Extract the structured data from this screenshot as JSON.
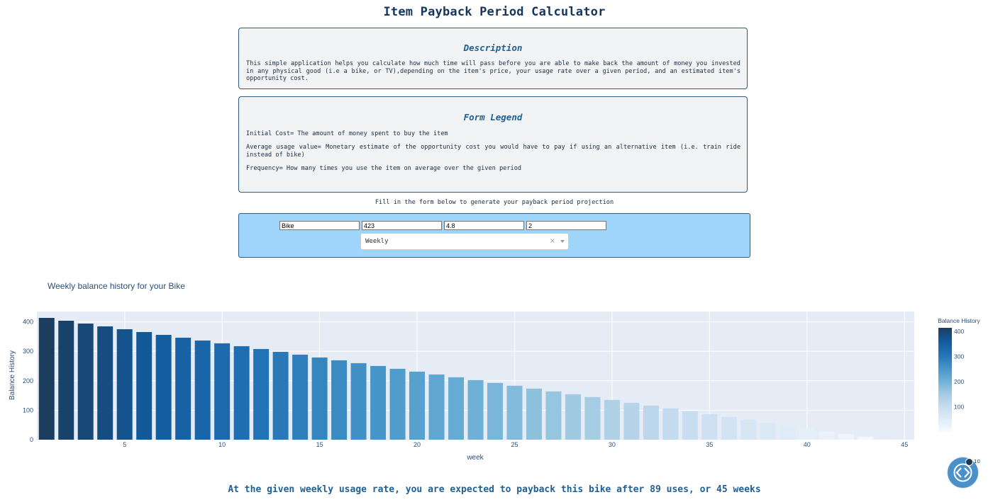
{
  "app": {
    "title": "Item Payback Period Calculator",
    "instruction": "Fill in the form below to generate your payback period projection",
    "result": "At the given weekly usage rate, you are expected to payback this bike after 89 uses, or 45 weeks"
  },
  "description": {
    "heading": "Description",
    "text": "This simple application helps you calculate how much time will pass before you are able to make back the amount of money you invested in any physical good (i.e a bike, or TV),depending on the item's price, your usage rate over a given period, and an estimated item's opportunity cost."
  },
  "legend": {
    "heading": "Form Legend",
    "initial_cost": "Initial Cost= The amount of money spent to buy the item",
    "average_usage": "Average usage value= Monetary estimate of the opportunity cost you would have to pay if using an alternative item (i.e. train ride instead of bike)",
    "frequency": "Frequency= How many times you use the item on average over the given period"
  },
  "form": {
    "item_value": "Bike",
    "initial_cost_value": "423",
    "usage_value": "4.8",
    "frequency_value": "2",
    "period_selected": "Weekly"
  },
  "fab": {
    "count": "10"
  },
  "colors": {
    "accent": "#1f5f93",
    "form_bg": "#9fd5fb",
    "plot_bg": "#e5ecf6",
    "bar_high": "#1b3d5e",
    "bar_low": "#f7f9fc"
  },
  "chart_data": {
    "type": "bar",
    "title": "Weekly balance history for your Bike",
    "xlabel": "week",
    "ylabel": "Balance History",
    "colorbar_title": "Balance History",
    "x": [
      1,
      2,
      3,
      4,
      5,
      6,
      7,
      8,
      9,
      10,
      11,
      12,
      13,
      14,
      15,
      16,
      17,
      18,
      19,
      20,
      21,
      22,
      23,
      24,
      25,
      26,
      27,
      28,
      29,
      30,
      31,
      32,
      33,
      34,
      35,
      36,
      37,
      38,
      39,
      40,
      41,
      42,
      43,
      44,
      45
    ],
    "values": [
      413.4,
      403.8,
      394.2,
      384.6,
      375,
      365.4,
      355.8,
      346.2,
      336.6,
      327,
      317.4,
      307.8,
      298.2,
      288.6,
      279,
      269.4,
      259.8,
      250.2,
      240.6,
      231,
      221.4,
      211.8,
      202.2,
      192.6,
      183,
      173.4,
      163.8,
      154.2,
      144.6,
      135,
      125.4,
      115.8,
      106.2,
      96.6,
      87,
      77.4,
      67.8,
      58.2,
      48.6,
      39,
      29.4,
      19.8,
      10.2,
      0.6,
      0
    ],
    "xlim": [
      0.5,
      45.5
    ],
    "ylim": [
      0,
      435
    ],
    "xticks": [
      5,
      10,
      15,
      20,
      25,
      30,
      35,
      40,
      45
    ],
    "yticks": [
      0,
      100,
      200,
      300,
      400
    ],
    "colorbar_ticks": [
      100,
      200,
      300,
      400
    ],
    "grid": true,
    "colorscale": "Blues"
  }
}
